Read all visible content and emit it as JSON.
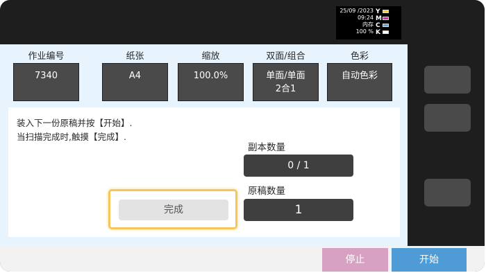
{
  "status": {
    "date": "25/09 /2023",
    "time": "09:24",
    "memory_label": "内存",
    "memory_value": "100 %",
    "toner_letters": [
      "Y",
      "M",
      "C",
      "K"
    ],
    "toner_colors": [
      "#f3d21b",
      "#d62a9c",
      "#5aa9e6",
      "#ffffff"
    ]
  },
  "settings": {
    "job_number": {
      "label": "作业编号",
      "value": "7340"
    },
    "paper": {
      "label": "纸张",
      "value": "A4"
    },
    "zoom": {
      "label": "缩放",
      "value": "100.0%"
    },
    "duplex": {
      "label": "双面/组合",
      "value_line1": "单面/单面",
      "value_line2": "2合1"
    },
    "color": {
      "label": "色彩",
      "value": "自动色彩"
    }
  },
  "instructions": {
    "line1": "装入下一份原稿并按【开始】.",
    "line2": "当扫描完成时,触摸【完成】."
  },
  "copies": {
    "label": "副本数量",
    "value": "0 / 1"
  },
  "originals": {
    "label": "原稿数量",
    "value": "1"
  },
  "buttons": {
    "done": "完成",
    "stop": "停止",
    "start": "开始"
  }
}
